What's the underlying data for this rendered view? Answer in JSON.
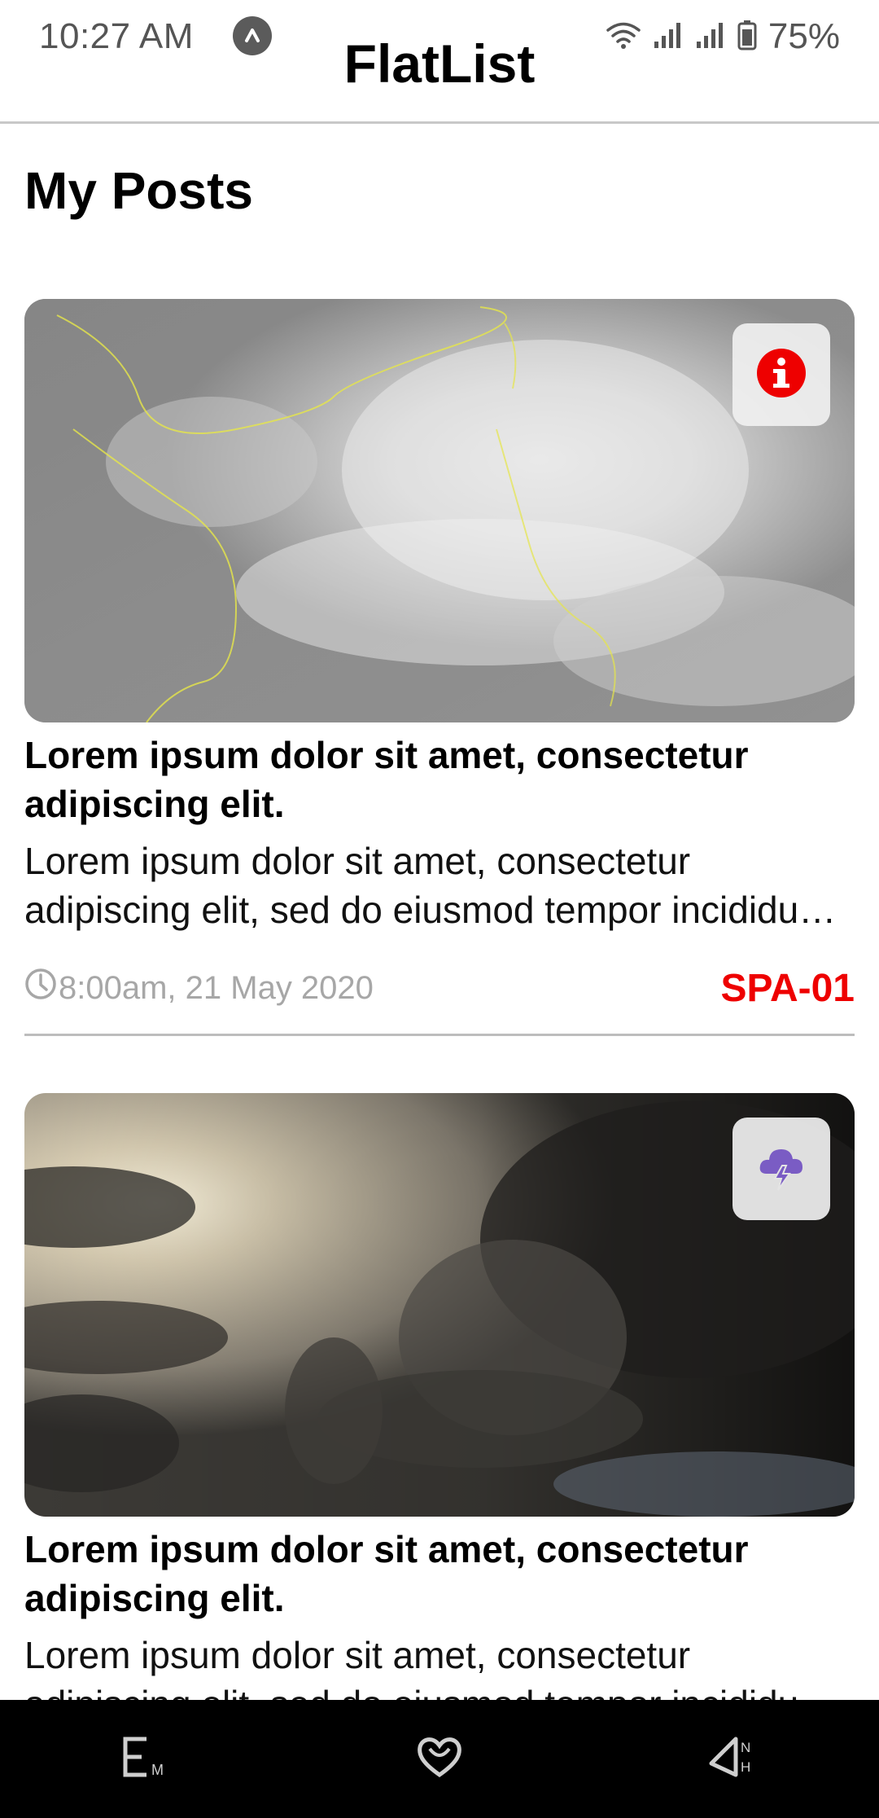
{
  "status_bar": {
    "time": "10:27 AM",
    "battery": "75%",
    "icons": [
      "app-notification-icon",
      "wifi-icon",
      "signal-icon",
      "signal-icon",
      "battery-icon"
    ]
  },
  "header": {
    "title": "FlatList"
  },
  "main": {
    "section_title": "My Posts",
    "posts": [
      {
        "title": "Lorem ipsum dolor sit amet, consectetur adipiscing elit.",
        "body": "Lorem ipsum dolor sit amet, consectetur adipiscing elit, sed do eiusmod tempor incididunt ut labore et dolore magna aliqua.",
        "timestamp": "8:00am, 21 May 2020",
        "code": "SPA-01",
        "badge_icon": "info-icon",
        "image": "satellite-typhoon-image"
      },
      {
        "title": "Lorem ipsum dolor sit amet, consectetur adipiscing elit.",
        "body": "Lorem ipsum dolor sit amet, consectetur adipiscing elit, sed do eiusmod tempor incididunt ut labore et dolore magna aliqua.",
        "badge_icon": "thunderstorm-icon",
        "image": "storm-clouds-image"
      }
    ]
  },
  "colors": {
    "accent_red": "#ee0000",
    "meta_gray": "#a7a7a7",
    "storm_icon": "#7a5cc4"
  },
  "bottom_nav": {
    "icons": [
      "em-icon",
      "heart-icon",
      "nh-navigation-icon"
    ]
  }
}
